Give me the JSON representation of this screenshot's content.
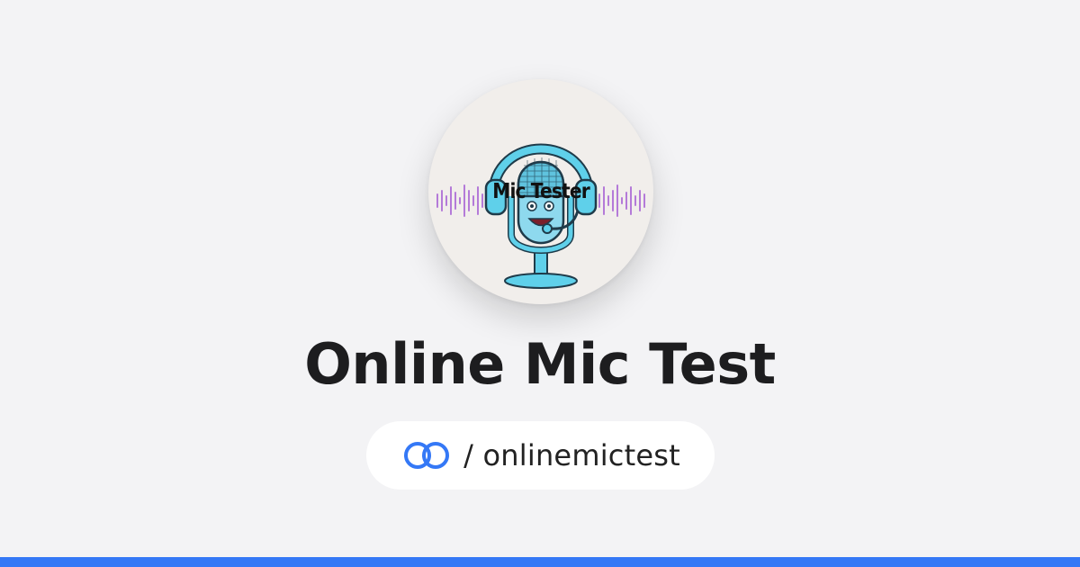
{
  "logo": {
    "title": "Mic Tester",
    "icon": "microphone-with-headphones-icon"
  },
  "page": {
    "title": "Online Mic Test"
  },
  "profile_link": {
    "icon": "link-icon",
    "handle": "/ onlinemictest"
  },
  "colors": {
    "background": "#f3f3f5",
    "accent": "#3478f6",
    "mic": "#5fd0ea",
    "wave": "#b47ad8"
  }
}
